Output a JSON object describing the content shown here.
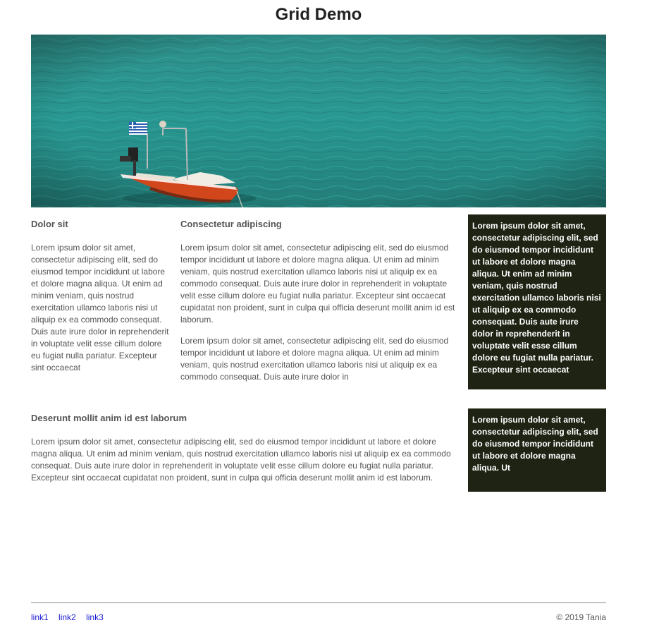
{
  "header": {
    "title": "Grid Demo"
  },
  "hero": {
    "alt": "Red boat on turquoise water"
  },
  "left_column": {
    "heading": "Dolor sit",
    "text": "Lorem ipsum dolor sit amet, consectetur adipiscing elit, sed do eiusmod tempor incididunt ut labore et dolore magna aliqua. Ut enim ad minim veniam, quis nostrud exercitation ullamco laboris nisi ut aliquip ex ea commodo consequat. Duis aute irure dolor in reprehenderit in voluptate velit esse cillum dolore eu fugiat nulla pariatur. Excepteur sint occaecat"
  },
  "middle_column": {
    "heading": "Consectetur adipiscing",
    "paragraph1": "Lorem ipsum dolor sit amet, consectetur adipiscing elit, sed do eiusmod tempor incididunt ut labore et dolore magna aliqua. Ut enim ad minim veniam, quis nostrud exercitation ullamco laboris nisi ut aliquip ex ea commodo consequat. Duis aute irure dolor in reprehenderit in voluptate velit esse cillum dolore eu fugiat nulla pariatur. Excepteur sint occaecat cupidatat non proident, sunt in culpa qui officia deserunt mollit anim id est laborum.",
    "paragraph2": "Lorem ipsum dolor sit amet, consectetur adipiscing elit, sed do eiusmod tempor incididunt ut labore et dolore magna aliqua. Ut enim ad minim veniam, quis nostrud exercitation ullamco laboris nisi ut aliquip ex ea commodo consequat. Duis aute irure dolor in"
  },
  "sidebar_box_1": {
    "text": "Lorem ipsum dolor sit amet, consectetur adipiscing elit, sed do eiusmod tempor incididunt ut labore et dolore magna aliqua. Ut enim ad minim veniam, quis nostrud exercitation ullamco laboris nisi ut aliquip ex ea commodo consequat. Duis aute irure dolor in reprehenderit in voluptate velit esse cillum dolore eu fugiat nulla pariatur. Excepteur sint occaecat"
  },
  "wide_section": {
    "heading": "Deserunt mollit anim id est laborum",
    "text": "Lorem ipsum dolor sit amet, consectetur adipiscing elit, sed do eiusmod tempor incididunt ut labore et dolore magna aliqua. Ut enim ad minim veniam, quis nostrud exercitation ullamco laboris nisi ut aliquip ex ea commodo consequat. Duis aute irure dolor in reprehenderit in voluptate velit esse cillum dolore eu fugiat nulla pariatur. Excepteur sint occaecat cupidatat non proident, sunt in culpa qui officia deserunt mollit anim id est laborum."
  },
  "sidebar_box_2": {
    "text": "Lorem ipsum dolor sit amet, consectetur adipiscing elit, sed do eiusmod tempor incididunt ut labore et dolore magna aliqua. Ut"
  },
  "footer": {
    "links": [
      "link1",
      "link2",
      "link3"
    ],
    "copyright": "© 2019 Tania"
  },
  "colors": {
    "dark_box": "#1f2314",
    "link": "#1a1ad6",
    "water": "#2a8a84"
  }
}
